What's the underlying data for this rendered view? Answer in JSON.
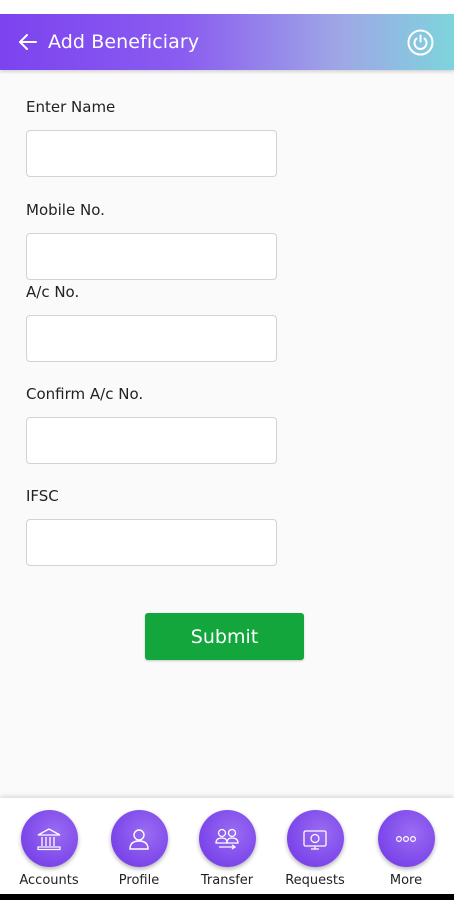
{
  "header": {
    "title": "Add Beneficiary",
    "back_icon": "arrow-left-icon",
    "power_icon": "power-icon",
    "gradient_colors": [
      "#7c43ef",
      "#9fa7e6",
      "#7dd4dc"
    ]
  },
  "form": {
    "name_label": "Enter Name",
    "name_value": "",
    "mobile_label": "Mobile No.",
    "mobile_value": "",
    "account_label": "A/c No.",
    "account_value": "",
    "confirm_account_label": "Confirm A/c No.",
    "confirm_account_value": "",
    "ifsc_label": "IFSC",
    "ifsc_value": "",
    "submit_label": "Submit",
    "submit_color": "#13a63d"
  },
  "bottom_nav": {
    "items": [
      {
        "label": "Accounts",
        "icon": "bank-icon"
      },
      {
        "label": "Profile",
        "icon": "user-icon"
      },
      {
        "label": "Transfer",
        "icon": "transfer-users-icon"
      },
      {
        "label": "Requests",
        "icon": "requests-icon"
      },
      {
        "label": "More",
        "icon": "more-icon"
      }
    ],
    "accent": "#7b45ea"
  }
}
